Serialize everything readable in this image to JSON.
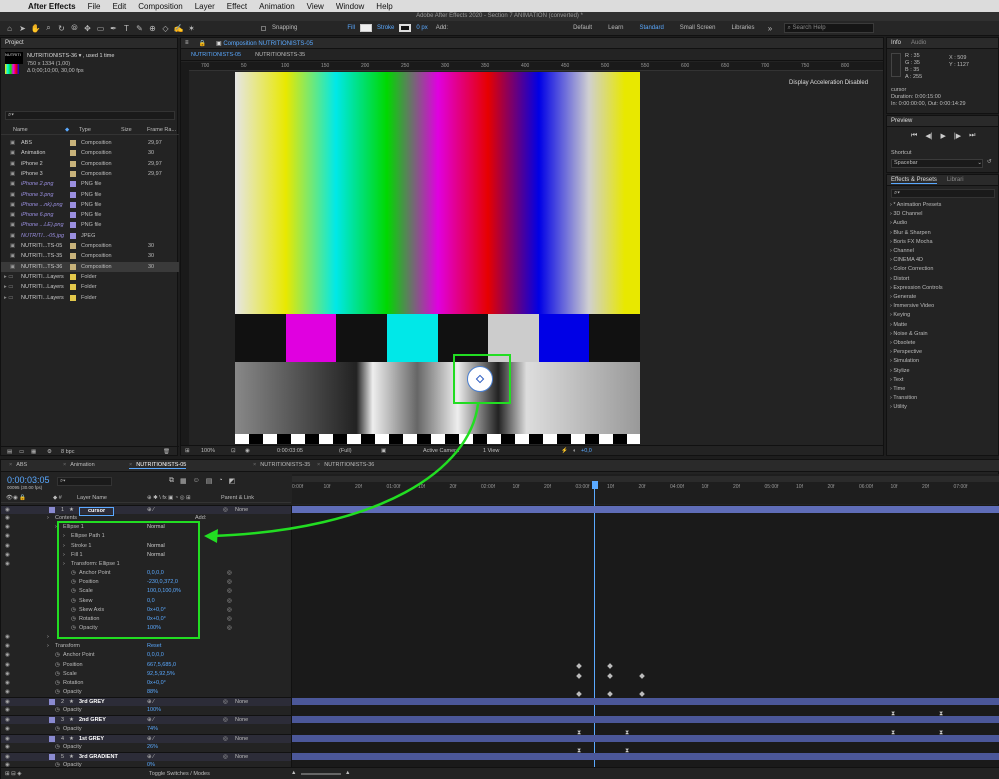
{
  "menubar": {
    "app": "After Effects",
    "items": [
      "File",
      "Edit",
      "Composition",
      "Layer",
      "Effect",
      "Animation",
      "View",
      "Window",
      "Help"
    ]
  },
  "titlebar": {
    "title": "Adobe After Effects 2020 - Section 7 ANIMATION (converted) *"
  },
  "toolbar": {
    "snapping": "Snapping",
    "fill": "Fill",
    "stroke": "Stroke",
    "stroke_px": "0 px",
    "add": "Add:",
    "workspaces": [
      "Default",
      "Learn",
      "Standard",
      "Small Screen",
      "Libraries"
    ],
    "active_workspace": "Standard",
    "search_placeholder": "Search Help"
  },
  "project": {
    "tab": "Project",
    "comp_name": "NUTRITIONISTS-36 ▾ , used 1 time",
    "dims": "750 x 1334 (1,00)",
    "duration": "Δ 0;00;10;00, 30,00 fps",
    "thumb_label": "NUTRITI",
    "cols": [
      "Name",
      "Type",
      "Size",
      "Frame Ra..."
    ],
    "items": [
      {
        "name": "ABS",
        "type": "Composition",
        "fps": "29,97",
        "color": "#c7b27a",
        "kind": "comp"
      },
      {
        "name": "Animation",
        "type": "Composition",
        "fps": "30",
        "color": "#c7b27a",
        "kind": "comp"
      },
      {
        "name": "iPhone 2",
        "type": "Composition",
        "fps": "29,97",
        "color": "#c7b27a",
        "kind": "comp"
      },
      {
        "name": "iPhone 3",
        "type": "Composition",
        "fps": "29,97",
        "color": "#c7b27a",
        "kind": "comp"
      },
      {
        "name": "iPhone 2.png",
        "type": "PNG file",
        "fps": "",
        "color": "#9a8fe0",
        "kind": "file"
      },
      {
        "name": "iPhone 3.png",
        "type": "PNG file",
        "fps": "",
        "color": "#9a8fe0",
        "kind": "file"
      },
      {
        "name": "iPhone ...nk).png",
        "type": "PNG file",
        "fps": "",
        "color": "#9a8fe0",
        "kind": "file"
      },
      {
        "name": "iPhone 6.png",
        "type": "PNG file",
        "fps": "",
        "color": "#9a8fe0",
        "kind": "file"
      },
      {
        "name": "iPhone ...LE).png",
        "type": "PNG file",
        "fps": "",
        "color": "#9a8fe0",
        "kind": "file"
      },
      {
        "name": "NUTRITI...-05.jpg",
        "type": "JPEG",
        "fps": "",
        "color": "#9a8fe0",
        "kind": "file"
      },
      {
        "name": "NUTRITI...TS-05",
        "type": "Composition",
        "fps": "30",
        "color": "#c7b27a",
        "kind": "comp"
      },
      {
        "name": "NUTRITI...TS-35",
        "type": "Composition",
        "fps": "30",
        "color": "#c7b27a",
        "kind": "comp"
      },
      {
        "name": "NUTRITI...TS-36",
        "type": "Composition",
        "fps": "30",
        "color": "#c7b27a",
        "kind": "comp"
      },
      {
        "name": "NUTRITI...Layers",
        "type": "Folder",
        "fps": "",
        "color": "#e3c84b",
        "kind": "folder"
      },
      {
        "name": "NUTRITI...Layers",
        "type": "Folder",
        "fps": "",
        "color": "#e3c84b",
        "kind": "folder"
      },
      {
        "name": "NUTRITI...Layers",
        "type": "Folder",
        "fps": "",
        "color": "#e3c84b",
        "kind": "folder"
      }
    ],
    "bpc": "8 bpc"
  },
  "viewer": {
    "tab": "Composition NUTRITIONISTS-05",
    "subtabs": [
      "NUTRITIONISTS-05",
      "NUTRITIONISTS-35"
    ],
    "notice": "Display Acceleration Disabled",
    "ruler": [
      "700",
      "50",
      "100",
      "150",
      "200",
      "250",
      "300",
      "350",
      "400",
      "450",
      "500",
      "550",
      "600",
      "650",
      "700",
      "750",
      "800"
    ],
    "footer": {
      "zoom": "100%",
      "timecode": "0:00:03:05",
      "res": "(Full)",
      "camera": "Active Camera",
      "view": "1 View",
      "exposure": "+0,0"
    }
  },
  "info": {
    "tabs": [
      "Info",
      "Audio"
    ],
    "r": "R : 35",
    "g": "G : 35",
    "b": "B : 35",
    "a": "A : 255",
    "x": "X : 509",
    "y": "Y : 1127",
    "layer": "cursor",
    "duration": "Duration: 0:00:15:00",
    "inout": "In: 0:00:00:00, Out: 0:00:14:29"
  },
  "preview": {
    "title": "Preview",
    "shortcut_label": "Shortcut",
    "shortcut": "Spacebar"
  },
  "effects": {
    "tabs": [
      "Effects & Presets",
      "Librari"
    ],
    "items": [
      "* Animation Presets",
      "3D Channel",
      "Audio",
      "Blur & Sharpen",
      "Boris FX Mocha",
      "Channel",
      "CINEMA 4D",
      "Color Correction",
      "Distort",
      "Expression Controls",
      "Generate",
      "Immersive Video",
      "Keying",
      "Matte",
      "Noise & Grain",
      "Obsolete",
      "Perspective",
      "Simulation",
      "Stylize",
      "Text",
      "Time",
      "Transition",
      "Utility"
    ]
  },
  "timeline": {
    "tabs": [
      "ABS",
      "Animation",
      "NUTRITIONISTS-05",
      "NUTRITIONISTS-35",
      "NUTRITIONISTS-36"
    ],
    "active_tab": "NUTRITIONISTS-05",
    "timecode": "0:00:03:05",
    "fps": "00095 (30.00 fps)",
    "col_layer": "Layer Name",
    "col_parent": "Parent & Link",
    "toggle": "Toggle Switches / Modes",
    "ticks": [
      "0:00f",
      "10f",
      "20f",
      "01:00f",
      "10f",
      "20f",
      "02:00f",
      "10f",
      "20f",
      "03:00f",
      "10f",
      "20f",
      "04:00f",
      "10f",
      "20f",
      "05:00f",
      "10f",
      "20f",
      "06:00f",
      "10f",
      "20f",
      "07:00f"
    ],
    "rows": [
      {
        "t": "layer",
        "num": "1",
        "name": "cursor",
        "parent": "None",
        "indent": 0
      },
      {
        "t": "prop",
        "name": "Contents",
        "val": "",
        "extra": "Add:",
        "indent": 1
      },
      {
        "t": "prop",
        "name": "Ellipse 1",
        "val": "Normal",
        "indent": 2
      },
      {
        "t": "prop",
        "name": "Ellipse Path 1",
        "val": "",
        "indent": 3
      },
      {
        "t": "prop",
        "name": "Stroke 1",
        "val": "Normal",
        "indent": 3
      },
      {
        "t": "prop",
        "name": "Fill 1",
        "val": "Normal",
        "indent": 3
      },
      {
        "t": "prop",
        "name": "Transform: Ellipse 1",
        "val": "",
        "indent": 3
      },
      {
        "t": "prop",
        "name": "Anchor Point",
        "val": "0,0,0,0",
        "indent": 4
      },
      {
        "t": "prop",
        "name": "Position",
        "val": "-230,0,372,0",
        "indent": 4
      },
      {
        "t": "prop",
        "name": "Scale",
        "val": "100,0,100,0%",
        "indent": 4
      },
      {
        "t": "prop",
        "name": "Skew",
        "val": "0,0",
        "indent": 4
      },
      {
        "t": "prop",
        "name": "Skew Axis",
        "val": "0x+0,0°",
        "indent": 4
      },
      {
        "t": "prop",
        "name": "Rotation",
        "val": "0x+0,0°",
        "indent": 4
      },
      {
        "t": "prop",
        "name": "Opacity",
        "val": "100%",
        "indent": 4
      },
      {
        "t": "prop",
        "name": "",
        "val": "",
        "indent": 1
      },
      {
        "t": "prop",
        "name": "Transform",
        "val": "Reset",
        "indent": 1
      },
      {
        "t": "prop",
        "name": "Anchor Point",
        "val": "0,0,0,0",
        "indent": 2
      },
      {
        "t": "prop",
        "name": "Position",
        "val": "667,5,685,0",
        "indent": 2
      },
      {
        "t": "prop",
        "name": "Scale",
        "val": "92,5,92,5%",
        "indent": 2
      },
      {
        "t": "prop",
        "name": "Rotation",
        "val": "0x+0,0°",
        "indent": 2
      },
      {
        "t": "prop",
        "name": "Opacity",
        "val": "88%",
        "indent": 2
      },
      {
        "t": "layer",
        "num": "2",
        "name": "3rd GREY",
        "parent": "None",
        "indent": 0
      },
      {
        "t": "prop",
        "name": "Opacity",
        "val": "100%",
        "indent": 2
      },
      {
        "t": "layer",
        "num": "3",
        "name": "2nd GREY",
        "parent": "None",
        "indent": 0
      },
      {
        "t": "prop",
        "name": "Opacity",
        "val": "74%",
        "indent": 2
      },
      {
        "t": "layer",
        "num": "4",
        "name": "1st GREY",
        "parent": "None",
        "indent": 0
      },
      {
        "t": "prop",
        "name": "Opacity",
        "val": "26%",
        "indent": 2
      },
      {
        "t": "layer",
        "num": "5",
        "name": "3rd GRADIENT",
        "parent": "None",
        "indent": 0
      },
      {
        "t": "prop",
        "name": "Opacity",
        "val": "0%",
        "indent": 2
      }
    ]
  },
  "colors": {
    "accent": "#2d8ceb",
    "highlight": "#22dd22",
    "bars": [
      "#e6e6e6",
      "#e7e700",
      "#00e8e8",
      "#00d600",
      "#e600e6",
      "#e60000",
      "#0000e6"
    ]
  }
}
